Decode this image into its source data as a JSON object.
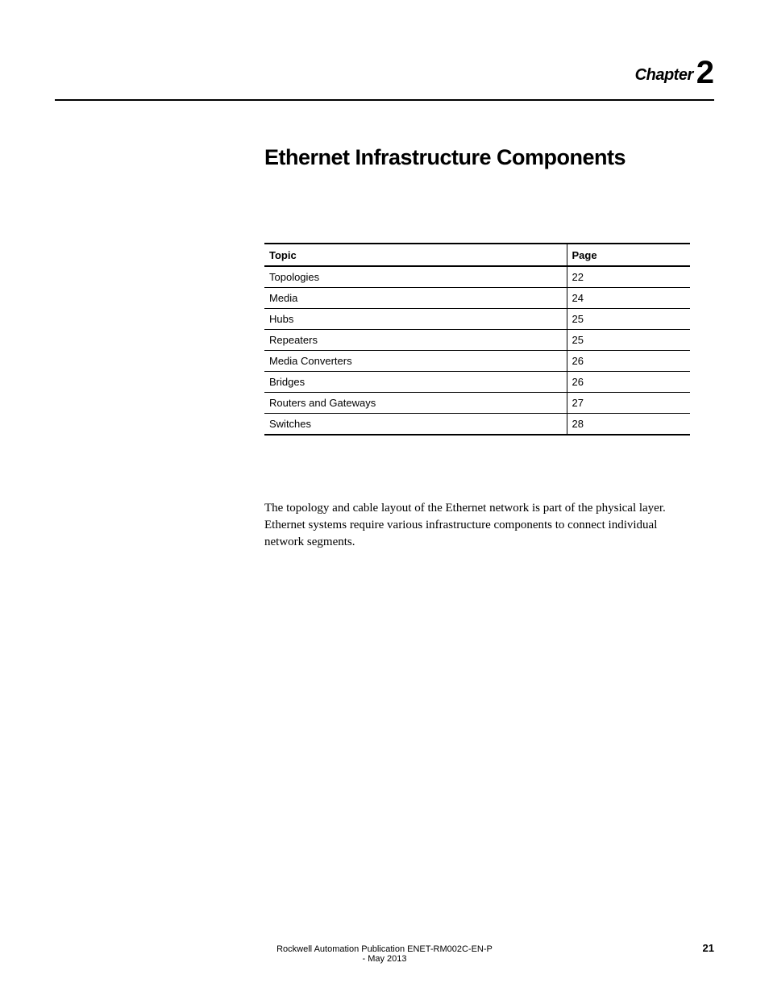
{
  "chapter": {
    "label": "Chapter",
    "number": "2"
  },
  "title": "Ethernet Infrastructure Components",
  "toc": {
    "headers": {
      "topic": "Topic",
      "page": "Page"
    },
    "rows": [
      {
        "topic": "Topologies",
        "page": "22"
      },
      {
        "topic": "Media",
        "page": "24"
      },
      {
        "topic": "Hubs",
        "page": "25"
      },
      {
        "topic": "Repeaters",
        "page": "25"
      },
      {
        "topic": "Media Converters",
        "page": "26"
      },
      {
        "topic": "Bridges",
        "page": "26"
      },
      {
        "topic": "Routers and Gateways",
        "page": "27"
      },
      {
        "topic": "Switches",
        "page": "28"
      }
    ]
  },
  "body": "The topology and cable layout of the Ethernet network is part of the physical layer. Ethernet systems require various infrastructure components to connect individual network segments.",
  "footer": {
    "publication": "Rockwell Automation Publication ENET-RM002C-EN-P - May 2013",
    "page_number": "21"
  }
}
